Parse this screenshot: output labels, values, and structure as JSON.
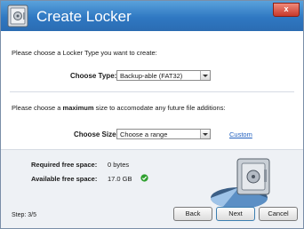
{
  "window": {
    "title": "Create Locker",
    "close_label": "x"
  },
  "locker_type": {
    "instruction": "Please choose a Locker Type you want to create:",
    "label": "Choose Type:",
    "selected": "Backup-able (FAT32)"
  },
  "size": {
    "instruction_prefix": "Please choose a ",
    "instruction_bold": "maximum",
    "instruction_suffix": " size to accomodate any future file additions:",
    "label": "Choose Size:",
    "selected": "Choose a range",
    "custom_link": "Custom"
  },
  "space": {
    "required_label": "Required free space:",
    "required_value": "0 bytes",
    "available_label": "Available free space:",
    "available_value": "17.0 GB",
    "status_color": "#2ea02e"
  },
  "footer": {
    "step": "Step: 3/5",
    "back_label": "Back",
    "next_label": "Next",
    "cancel_label": "Cancel"
  },
  "icons": {
    "app": "safe-icon",
    "ok": "check-circle-icon",
    "illustration": "locker-pie-illustration"
  }
}
